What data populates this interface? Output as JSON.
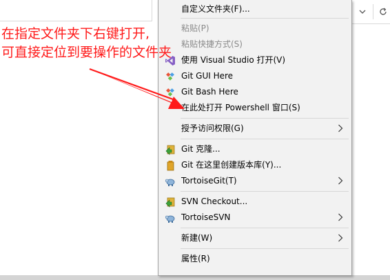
{
  "window": {
    "more_icon": "chevron-down-icon",
    "refresh_icon": "refresh-icon"
  },
  "menu": {
    "items": [
      {
        "label": "自定义文件夹(F)...",
        "icon": "",
        "disabled": false
      },
      {
        "label": "粘贴(P)",
        "icon": "",
        "disabled": true
      },
      {
        "label": "粘贴快捷方式(S)",
        "icon": "",
        "disabled": true
      },
      {
        "label": "使用 Visual Studio 打开(V)",
        "icon": "visual-studio-icon",
        "disabled": false
      },
      {
        "label": "Git GUI Here",
        "icon": "git-icon",
        "disabled": false
      },
      {
        "label": "Git Bash Here",
        "icon": "git-icon",
        "disabled": false
      },
      {
        "label": "在此处打开 Powershell 窗口(S)",
        "icon": "",
        "disabled": false
      },
      {
        "label": "授予访问权限(G)",
        "icon": "",
        "disabled": false,
        "submenu": true
      },
      {
        "label": "Git 克隆...",
        "icon": "git-clone-icon",
        "disabled": false
      },
      {
        "label": "Git 在这里创建版本库(Y)...",
        "icon": "git-create-repo-icon",
        "disabled": false
      },
      {
        "label": "TortoiseGit(T)",
        "icon": "tortoisegit-icon",
        "disabled": false,
        "submenu": true
      },
      {
        "label": "SVN Checkout...",
        "icon": "svn-checkout-icon",
        "disabled": false
      },
      {
        "label": "TortoiseSVN",
        "icon": "tortoisesvn-icon",
        "disabled": false,
        "submenu": true
      },
      {
        "label": "新建(W)",
        "icon": "",
        "disabled": false,
        "submenu": true
      },
      {
        "label": "属性(R)",
        "icon": "",
        "disabled": false
      }
    ]
  },
  "annotation": {
    "line1": "在指定文件夹下右键打开,",
    "line2": "可直接定位到要操作的文件夹",
    "color": "#ff1a1a"
  }
}
